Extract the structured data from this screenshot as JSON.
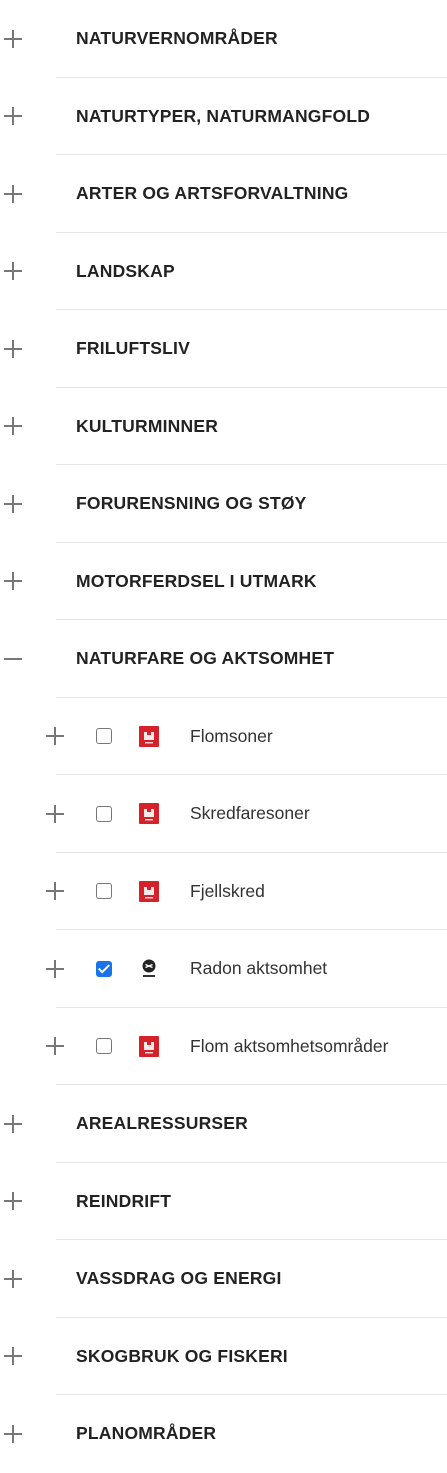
{
  "categories_top": [
    {
      "label": "NATURVERNOMRÅDER"
    },
    {
      "label": "NATURTYPER, NATURMANGFOLD"
    },
    {
      "label": "ARTER OG ARTSFORVALTNING"
    },
    {
      "label": "LANDSKAP"
    },
    {
      "label": "FRILUFTSLIV"
    },
    {
      "label": "KULTURMINNER"
    },
    {
      "label": "FORURENSNING OG STØY"
    },
    {
      "label": "MOTORFERDSEL I UTMARK"
    }
  ],
  "expanded_category": {
    "label": "NATURFARE OG AKTSOMHET",
    "layers": [
      {
        "label": "Flomsoner",
        "checked": false,
        "logo": "nve-logo-icon"
      },
      {
        "label": "Skredfaresoner",
        "checked": false,
        "logo": "nve-logo-icon"
      },
      {
        "label": "Fjellskred",
        "checked": false,
        "logo": "nve-logo-icon"
      },
      {
        "label": "Radon aktsomhet",
        "checked": true,
        "logo": "ngu-logo-icon"
      },
      {
        "label": "Flom aktsomhetsområder",
        "checked": false,
        "logo": "nve-logo-icon"
      }
    ]
  },
  "categories_bottom": [
    {
      "label": "AREALRESSURSER"
    },
    {
      "label": "REINDRIFT"
    },
    {
      "label": "VASSDRAG OG ENERGI"
    },
    {
      "label": "SKOGBRUK OG FISKERI"
    },
    {
      "label": "PLANOMRÅDER"
    }
  ],
  "colors": {
    "nve_red": "#d6202a",
    "checkbox_checked": "#1a73e8",
    "divider": "#e6e6e6"
  }
}
